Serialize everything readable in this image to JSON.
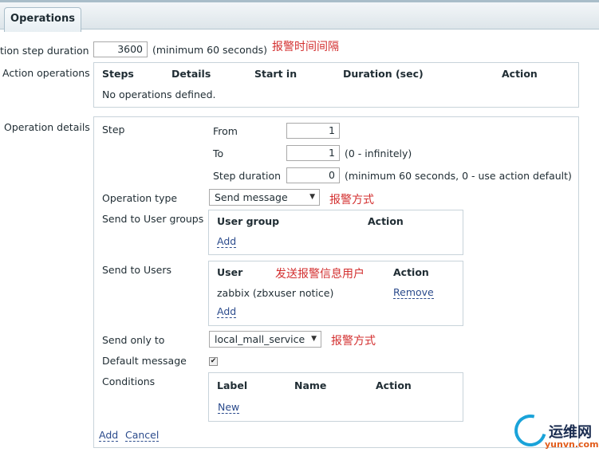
{
  "tabs": {
    "active": "Operations"
  },
  "step_duration": {
    "label": "tion step duration",
    "value": "3600",
    "hint": "(minimum 60 seconds)",
    "annotation": "报警时间间隔"
  },
  "action_operations": {
    "label": "Action operations",
    "columns": [
      "Steps",
      "Details",
      "Start in",
      "Duration (sec)",
      "Action"
    ],
    "empty_text": "No operations defined."
  },
  "operation_details": {
    "label": "Operation details",
    "step": {
      "label": "Step",
      "from_label": "From",
      "from_value": "1",
      "to_label": "To",
      "to_value": "1",
      "to_hint": "(0 - infinitely)",
      "duration_label": "Step duration",
      "duration_value": "0",
      "duration_hint": "(minimum 60 seconds, 0 - use action default)"
    },
    "operation_type": {
      "label": "Operation type",
      "selected": "Send message",
      "annotation": "报警方式"
    },
    "user_groups": {
      "label": "Send to User groups",
      "col_group": "User group",
      "col_action": "Action",
      "add_link": "Add"
    },
    "users": {
      "label": "Send to Users",
      "col_user": "User",
      "annotation": "发送报警信息用户",
      "col_action": "Action",
      "row_user": "zabbix (zbxuser notice)",
      "row_action": "Remove",
      "add_link": "Add"
    },
    "send_only_to": {
      "label": "Send only to",
      "selected": "local_mall_service",
      "annotation": "报警方式"
    },
    "default_message": {
      "label": "Default message",
      "checked": true
    },
    "conditions": {
      "label": "Conditions",
      "col_label": "Label",
      "col_name": "Name",
      "col_action": "Action",
      "new_link": "New"
    },
    "footer": {
      "add": "Add",
      "cancel": "Cancel"
    }
  },
  "watermark": {
    "text_cn": "运维网",
    "text_url": "yunvn.com"
  },
  "colors": {
    "link": "#2b4b8c",
    "annotation": "#d32f2f",
    "border": "#c8d3da"
  }
}
